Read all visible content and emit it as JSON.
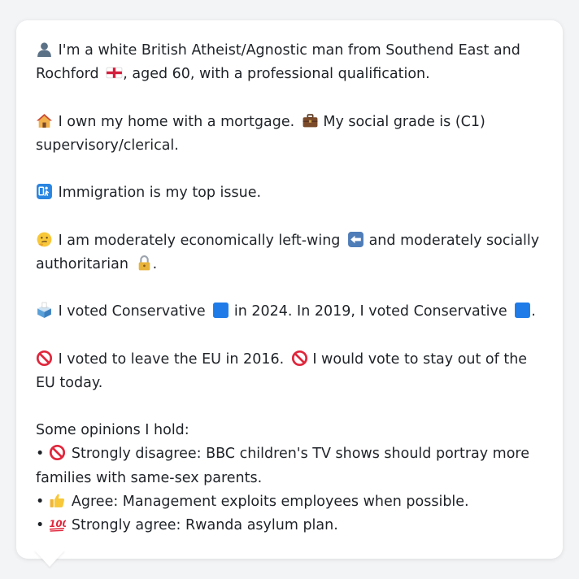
{
  "profile": {
    "line1": "I'm a white British Atheist/Agnostic man from Southend East and Rochford",
    "line1_suffix": ", aged 60, with a professional qualification.",
    "home": "I own my home with a mortgage.",
    "grade": "My social grade is (C1) supervisory/clerical.",
    "issue": "Immigration is my top issue.",
    "ideology_a": "I am moderately economically left-wing",
    "ideology_b": "and moderately socially authoritarian",
    "ideology_end": ".",
    "vote_a": "I voted Conservative",
    "vote_b": "in 2024. In 2019, I voted Conservative",
    "vote_end": ".",
    "eu_a": "I voted to leave the EU in 2016.",
    "eu_b": "I would vote to stay out of the EU today.",
    "opinions_heading": "Some opinions I hold:",
    "opinions": [
      {
        "bullet": "•",
        "text": "Strongly disagree: BBC children's TV shows should portray more families with same-sex parents."
      },
      {
        "bullet": "•",
        "text": "Agree: Management exploits employees when possible."
      },
      {
        "bullet": "•",
        "text": "Strongly agree: Rwanda asylum plan."
      }
    ]
  },
  "icons": {
    "person": "person-silhouette-icon",
    "flag": "england-flag-icon",
    "house": "house-icon",
    "briefcase": "briefcase-icon",
    "passport": "passport-control-icon",
    "thinking": "thinking-face-icon",
    "left_arrow": "left-arrow-icon",
    "lock": "lock-icon",
    "ballot": "ballot-box-icon",
    "blue_square": "blue-square-icon",
    "no_entry": "prohibited-icon",
    "thumbs_up": "thumbs-up-icon",
    "hundred": "hundred-points-icon"
  },
  "colors": {
    "text": "#1f2328",
    "bubble": "#ffffff",
    "background": "#f3f4f6",
    "conservative_blue": "#1e7be8",
    "prohibited_red": "#e0263b"
  }
}
